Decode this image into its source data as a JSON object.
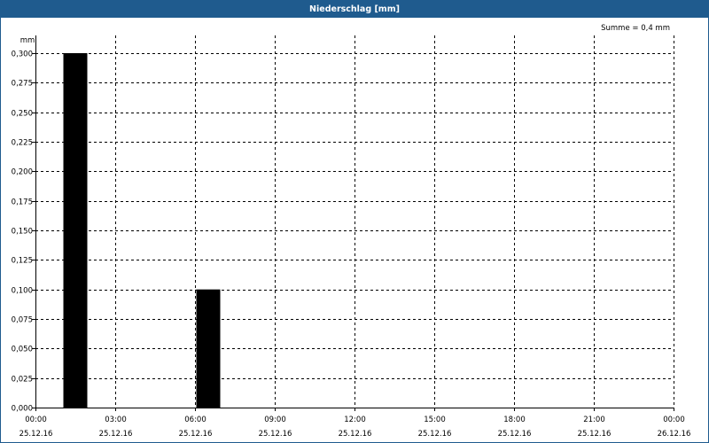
{
  "header": {
    "title": "Niederschlag [mm]"
  },
  "summary": {
    "sum_text": "Summe = 0,4 mm"
  },
  "colors": {
    "titlebar": "#1f5b8e",
    "bars": "#000000",
    "grid": "#000000"
  },
  "chart_data": {
    "type": "bar",
    "title": "Niederschlag [mm]",
    "ylabel": "mm",
    "xlabel": "",
    "ylim": [
      0,
      0.3
    ],
    "yticks": [
      0,
      0.025,
      0.05,
      0.075,
      0.1,
      0.125,
      0.15,
      0.175,
      0.2,
      0.225,
      0.25,
      0.275,
      0.3
    ],
    "ytick_labels": [
      "0,000",
      "0,025",
      "0,050",
      "0,075",
      "0,100",
      "0,125",
      "0,150",
      "0,175",
      "0,200",
      "0,225",
      "0,250",
      "0,275",
      "0,300"
    ],
    "xlim_hours": [
      0,
      24
    ],
    "xticks": [
      {
        "hour": 0,
        "time": "00:00",
        "date": "25.12.16"
      },
      {
        "hour": 3,
        "time": "03:00",
        "date": "25.12.16"
      },
      {
        "hour": 6,
        "time": "06:00",
        "date": "25.12.16"
      },
      {
        "hour": 9,
        "time": "09:00",
        "date": "25.12.16"
      },
      {
        "hour": 12,
        "time": "12:00",
        "date": "25.12.16"
      },
      {
        "hour": 15,
        "time": "15:00",
        "date": "25.12.16"
      },
      {
        "hour": 18,
        "time": "18:00",
        "date": "25.12.16"
      },
      {
        "hour": 21,
        "time": "21:00",
        "date": "25.12.16"
      },
      {
        "hour": 24,
        "time": "00:00",
        "date": "26.12.16"
      }
    ],
    "bars": [
      {
        "start_hour": 1,
        "end_hour": 2,
        "value": 0.3
      },
      {
        "start_hour": 6,
        "end_hour": 7,
        "value": 0.1
      }
    ],
    "grid": true,
    "grid_style": "dashed"
  }
}
